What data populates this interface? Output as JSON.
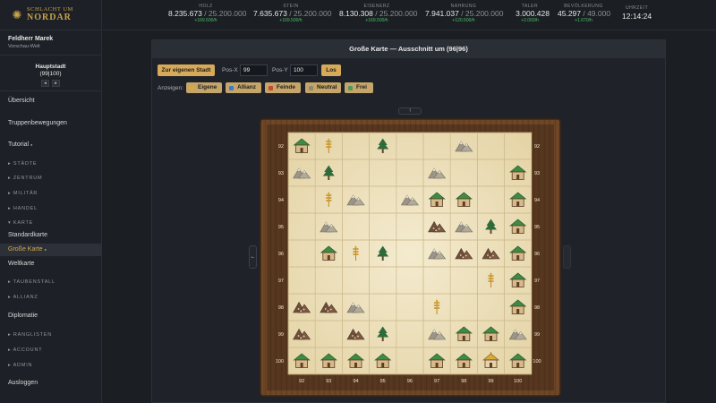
{
  "logo": {
    "line1": "SCHLACHT UM",
    "line2": "NORDAR"
  },
  "user": {
    "name": "Feldherr Marek",
    "world": "Vorschau-Welt"
  },
  "capital": {
    "name": "Hauptstadt",
    "coords": "(99|100)",
    "prev": "◂",
    "next": "▸"
  },
  "nav": {
    "overview": "Übersicht",
    "troops": "Truppenbewegungen",
    "tutorial": "Tutorial",
    "tutorial_dot": "●",
    "cities": "▸ STÄDTE",
    "center": "▸ ZENTRUM",
    "military": "▸ MILITÄR",
    "trade": "▸ HANDEL",
    "map": "▾ KARTE",
    "map_standard": "Standardkarte",
    "map_large": "Große Karte",
    "map_large_mark": "●",
    "map_world": "Weltkarte",
    "pigeons": "▸ TAUBENSTALL",
    "alliance": "▸ ALLIANZ",
    "diplomacy": "Diplomatie",
    "rankings": "▸ RANGLISTEN",
    "account": "▸ ACCOUNT",
    "admin": "▸ ADMIN",
    "logout": "Ausloggen"
  },
  "resources": [
    {
      "label": "HOLZ",
      "value": "8.235.673",
      "cap": " / 25.200.000",
      "rate": "+169.500/h"
    },
    {
      "label": "STEIN",
      "value": "7.635.673",
      "cap": " / 25.200.000",
      "rate": "+169.500/h"
    },
    {
      "label": "EISENERZ",
      "value": "8.130.308",
      "cap": " / 25.200.000",
      "rate": "+169.500/h"
    },
    {
      "label": "NAHRUNG",
      "value": "7.941.037",
      "cap": " / 25.200.000",
      "rate": "+120.500/h"
    },
    {
      "label": "TALER",
      "value": "3.000.428",
      "cap": "",
      "rate": "+2.093/h"
    },
    {
      "label": "BEVÖLKERUNG",
      "value": "45.297",
      "cap": " / 49.000",
      "rate": "+1.670/h"
    }
  ],
  "clock": {
    "label": "UHRZEIT",
    "value": "12:14:24"
  },
  "panel": {
    "title": "Große Karte — Ausschnitt um (96|96)",
    "own_city_button": "Zur eigenen Stadt",
    "pos_x_label": "Pos-X",
    "pos_x_value": "99",
    "pos_y_label": "Pos-Y",
    "pos_y_value": "100",
    "go_button": "Los",
    "show_label": "Anzeigen:",
    "filters": [
      {
        "label": "Eigene",
        "color": "#d9a93a"
      },
      {
        "label": "Allianz",
        "color": "#3b7dc4"
      },
      {
        "label": "Feinde",
        "color": "#c64a2e"
      },
      {
        "label": "Neutral",
        "color": "#8f8a6a"
      },
      {
        "label": "Frei",
        "color": "#4f9a5a"
      }
    ],
    "nav_up": "↑",
    "nav_left": "←"
  },
  "map": {
    "x_coords": [
      "92",
      "93",
      "94",
      "95",
      "96",
      "97",
      "98",
      "99",
      "100"
    ],
    "y_coords": [
      "92",
      "93",
      "94",
      "95",
      "96",
      "97",
      "98",
      "99",
      "100"
    ],
    "rows": [
      [
        "city",
        "field",
        "",
        "forest",
        "",
        "",
        "mountain",
        "",
        ""
      ],
      [
        "mountain",
        "forest",
        "",
        "",
        "",
        "mountain",
        "",
        "",
        "city"
      ],
      [
        "",
        "field",
        "mountain",
        "",
        "mountain",
        "city",
        "city",
        "",
        "city"
      ],
      [
        "",
        "mountain",
        "",
        "",
        "",
        "mine",
        "mountain",
        "forest",
        "city"
      ],
      [
        "",
        "city",
        "field",
        "forest",
        "",
        "mountain",
        "mine",
        "mine",
        "city"
      ],
      [
        "",
        "",
        "",
        "",
        "",
        "",
        "",
        "field",
        "city"
      ],
      [
        "mine",
        "mine",
        "mountain",
        "",
        "",
        "field",
        "",
        "",
        "city"
      ],
      [
        "mine",
        "",
        "mine",
        "forest",
        "",
        "mountain",
        "city",
        "city",
        "mountain"
      ],
      [
        "city",
        "city",
        "city",
        "city",
        "",
        "city",
        "city",
        "owncity",
        "city"
      ]
    ]
  },
  "colors": {
    "gold": "#d6aa58",
    "board_wood": "#6b4426",
    "tile_parchment": "#efe3c0",
    "roof_green": "#3f8a44",
    "house_tan": "#d8b98a",
    "mountain_gray": "#9c9486",
    "mine_brown": "#6e4f3a",
    "forest_green": "#2e6b3a",
    "field_gold": "#cf9f3a"
  }
}
